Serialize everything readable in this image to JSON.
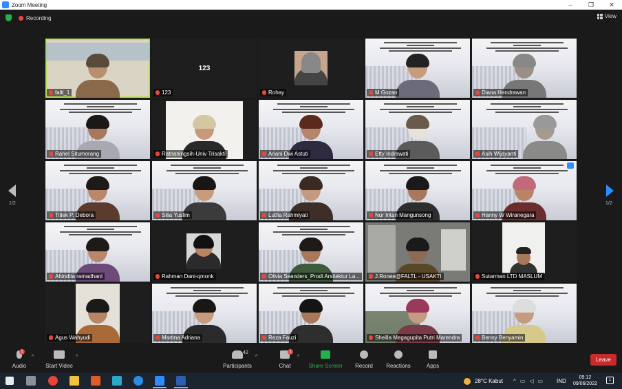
{
  "window": {
    "title": "Zoom Meeting",
    "minimize": "–",
    "maximize": "❐",
    "close": "✕"
  },
  "meeting": {
    "recording_label": "Recording",
    "view_label": "View"
  },
  "gallery": {
    "page_label_left": "1/2",
    "page_label_right": "1/2",
    "tiles": [
      {
        "name": "faltl_1"
      },
      {
        "name": "123",
        "center_text": "123"
      },
      {
        "name": "Rohay"
      },
      {
        "name": "M Gozan"
      },
      {
        "name": "Diana Hendrawan"
      },
      {
        "name": "Rahel Situmorang"
      },
      {
        "name": "Ratnaningsih-Univ Trisakti"
      },
      {
        "name": "Ariani Dwi Astuti"
      },
      {
        "name": "Etty Indrawati"
      },
      {
        "name": "Asih Wijayanti"
      },
      {
        "name": "Titiek P. Debora"
      },
      {
        "name": "Silia Yuslim"
      },
      {
        "name": "Lutfia Rahmiyati"
      },
      {
        "name": "Nur Intan Mangunsong"
      },
      {
        "name": "Hanny W Wiranegara"
      },
      {
        "name": "Ahindita ramadhani"
      },
      {
        "name": "Rahman Dani-qmonk"
      },
      {
        "name": "Olivia Seanders_Prodi Arsitektur La..."
      },
      {
        "name": "J.Ronee@FALTL - USAKTI"
      },
      {
        "name": "Sutarman LTD MASLUM"
      },
      {
        "name": "Agus Wahyudi"
      },
      {
        "name": "Martina Adriana"
      },
      {
        "name": "Reza Fauzi"
      },
      {
        "name": "Sheilla Megagupita Putri Marendra"
      },
      {
        "name": "Benny Benyamin"
      }
    ]
  },
  "toolbar": {
    "audio": "Audio",
    "start_video": "Start Video",
    "participants": "Participants",
    "participants_count": "42",
    "chat": "Chat",
    "chat_badge": "1",
    "audio_badge": "1",
    "share_screen": "Share Screen",
    "record": "Record",
    "reactions": "Reactions",
    "apps": "Apps",
    "leave": "Leave"
  },
  "taskbar": {
    "weather": "28°C  Kabut",
    "language": "IND",
    "time": "09.12",
    "date": "09/06/2022",
    "notifications": "1"
  },
  "colors": {
    "accent_green": "#23b14d",
    "leave_red": "#c92a2a",
    "active_speaker": "#b7e04e"
  }
}
